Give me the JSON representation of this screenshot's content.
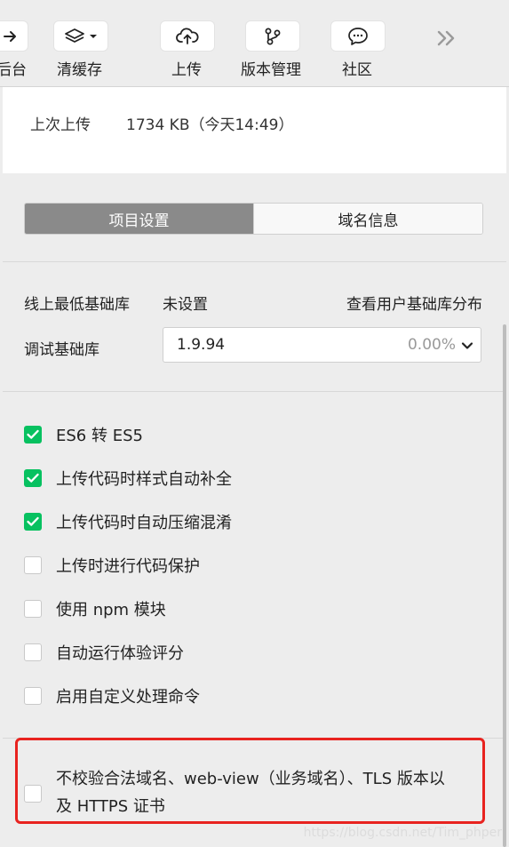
{
  "toolbar": {
    "items": [
      {
        "label": "后台",
        "icon": "arrow-right-icon"
      },
      {
        "label": "清缓存",
        "icon": "layers-icon"
      },
      {
        "label": "上传",
        "icon": "cloud-upload-icon"
      },
      {
        "label": "版本管理",
        "icon": "branch-icon"
      },
      {
        "label": "社区",
        "icon": "chat-bubble-icon"
      }
    ],
    "more_icon": "double-chevron-right-icon"
  },
  "upload_info": {
    "label": "上次上传",
    "value": "1734 KB（今天14:49）"
  },
  "tabs": [
    {
      "label": "项目设置",
      "active": true
    },
    {
      "label": "域名信息",
      "active": false
    }
  ],
  "library": {
    "min_label": "线上最低基础库",
    "min_value": "未设置",
    "distribution_link": "查看用户基础库分布",
    "debug_label": "调试基础库",
    "debug_value": "1.9.94",
    "debug_percent": "0.00%"
  },
  "options": [
    {
      "label": "ES6 转 ES5",
      "checked": true
    },
    {
      "label": "上传代码时样式自动补全",
      "checked": true
    },
    {
      "label": "上传代码时自动压缩混淆",
      "checked": true
    },
    {
      "label": "上传时进行代码保护",
      "checked": false
    },
    {
      "label": "使用 npm 模块",
      "checked": false
    },
    {
      "label": "自动运行体验评分",
      "checked": false
    },
    {
      "label": "启用自定义处理命令",
      "checked": false
    }
  ],
  "highlighted_option": {
    "label": "不校验合法域名、web-view（业务域名）、TLS 版本以及 HTTPS 证书",
    "checked": false
  },
  "watermark": "https://blog.csdn.net/Tim_phper",
  "colors": {
    "accent_green": "#07c160",
    "highlight_red": "#e8231f",
    "active_tab": "#8a8a8a"
  }
}
